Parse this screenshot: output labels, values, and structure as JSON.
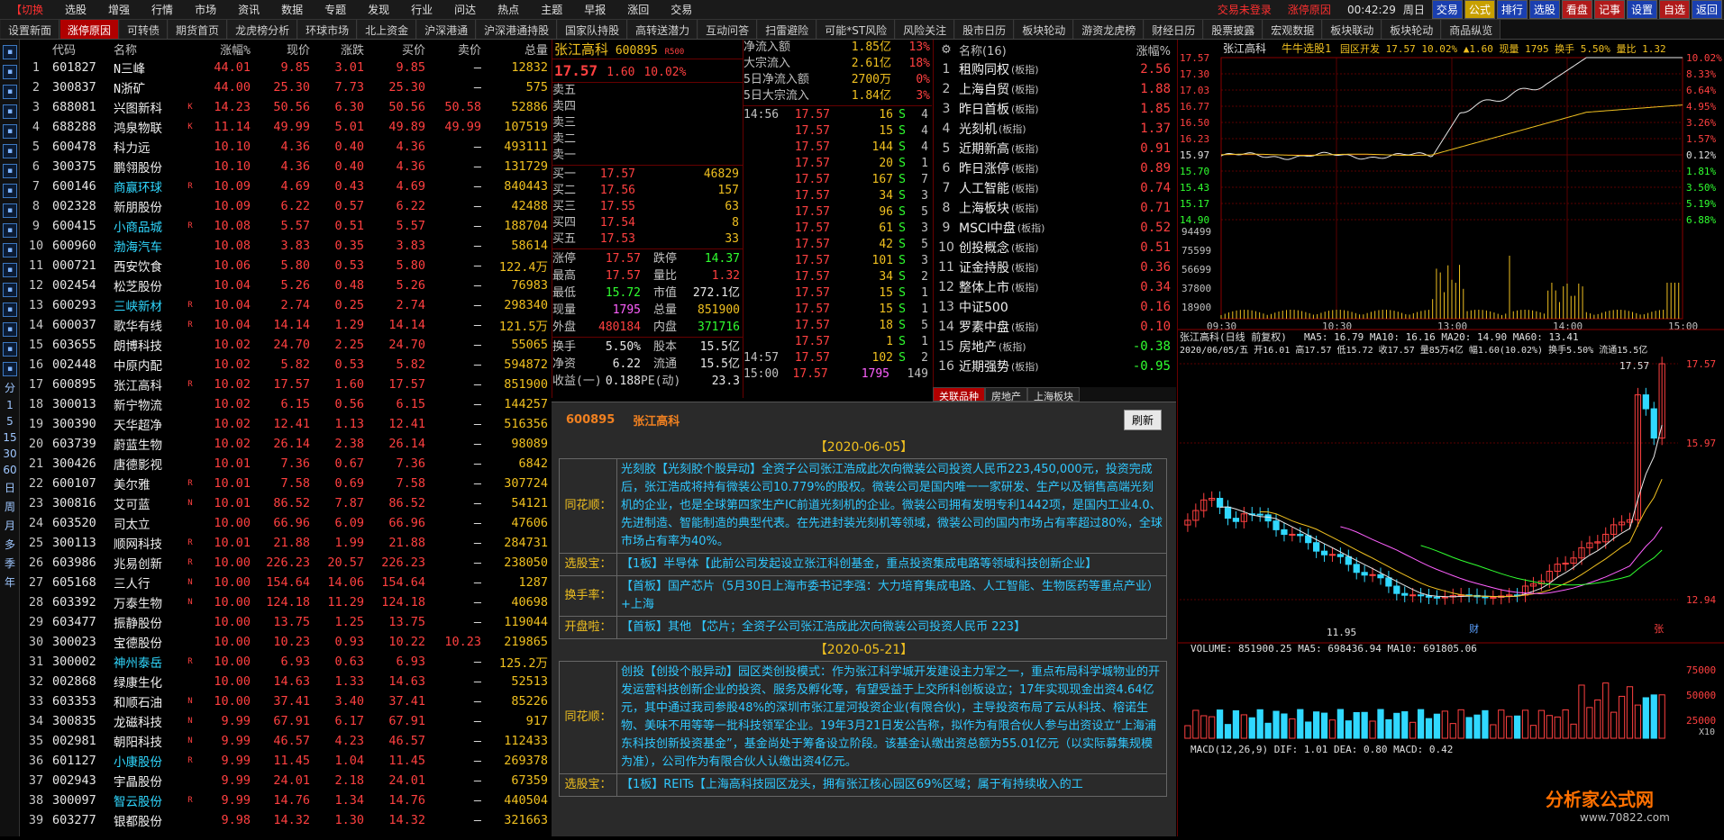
{
  "menubar": {
    "logo": "【切换",
    "items": [
      "选股",
      "增强",
      "行情",
      "市场",
      "资讯",
      "数据",
      "专题",
      "发现",
      "行业",
      "问达",
      "热点",
      "主题",
      "早报",
      "涨回",
      "交易"
    ],
    "alerts": [
      "交易未登录",
      "涨停原因"
    ],
    "time": "00:42:29",
    "weekday": "周日",
    "toolbuttons": [
      "交易",
      "公式",
      "排行",
      "选股",
      "看盘",
      "记事",
      "设置",
      "自选",
      "返回"
    ]
  },
  "tabs": [
    "设置新面",
    "涨停原因",
    "可转债",
    "期货首页",
    "龙虎榜分析",
    "环球市场",
    "北上资金",
    "沪深港通",
    "沪深港通持股",
    "国家队持股",
    "高转送潜力",
    "互动问答",
    "扫雷避险",
    "可能*ST风险",
    "风险关注",
    "股市日历",
    "板块轮动",
    "游资龙虎榜",
    "财经日历",
    "股票披露",
    "宏观数据",
    "板块联动",
    "板块轮动",
    "商品纵览"
  ],
  "active_tab": 1,
  "sidebar": {
    "periods": [
      "分",
      "1",
      "5",
      "15",
      "30",
      "60",
      "日",
      "周",
      "月",
      "多",
      "季",
      "年"
    ]
  },
  "list": {
    "headers": [
      "",
      "代码",
      "名称",
      "涨幅%",
      "现价",
      "涨跌",
      "买价",
      "卖价",
      "总量"
    ],
    "rows": [
      [
        "1",
        "601827",
        "N三峰",
        "",
        "44.01",
        "9.85",
        "3.01",
        "9.85",
        "–",
        "12832"
      ],
      [
        "2",
        "300837",
        "N浙矿",
        "",
        "44.00",
        "25.30",
        "7.73",
        "25.30",
        "–",
        "575"
      ],
      [
        "3",
        "688081",
        "兴图新科",
        "K",
        "14.23",
        "50.56",
        "6.30",
        "50.56",
        "50.58",
        "52886"
      ],
      [
        "4",
        "688288",
        "鸿泉物联",
        "K",
        "11.14",
        "49.99",
        "5.01",
        "49.89",
        "49.99",
        "107519"
      ],
      [
        "5",
        "600478",
        "科力远",
        "",
        "10.10",
        "4.36",
        "0.40",
        "4.36",
        "–",
        "493111"
      ],
      [
        "6",
        "300375",
        "鹏翎股份",
        "",
        "10.10",
        "4.36",
        "0.40",
        "4.36",
        "–",
        "131729"
      ],
      [
        "7",
        "600146",
        "商赢环球",
        "R",
        "10.09",
        "4.69",
        "0.43",
        "4.69",
        "–",
        "840443"
      ],
      [
        "8",
        "002328",
        "新朋股份",
        "",
        "10.09",
        "6.22",
        "0.57",
        "6.22",
        "–",
        "42488"
      ],
      [
        "9",
        "600415",
        "小商品城",
        "R",
        "10.08",
        "5.57",
        "0.51",
        "5.57",
        "–",
        "188704"
      ],
      [
        "10",
        "600960",
        "渤海汽车",
        "",
        "10.08",
        "3.83",
        "0.35",
        "3.83",
        "–",
        "58614"
      ],
      [
        "11",
        "000721",
        "西安饮食",
        "",
        "10.06",
        "5.80",
        "0.53",
        "5.80",
        "–",
        "122.4万"
      ],
      [
        "12",
        "002454",
        "松芝股份",
        "",
        "10.04",
        "5.26",
        "0.48",
        "5.26",
        "–",
        "76983"
      ],
      [
        "13",
        "600293",
        "三峡新材",
        "R",
        "10.04",
        "2.74",
        "0.25",
        "2.74",
        "–",
        "298340"
      ],
      [
        "14",
        "600037",
        "歌华有线",
        "R",
        "10.04",
        "14.14",
        "1.29",
        "14.14",
        "–",
        "121.5万"
      ],
      [
        "15",
        "603655",
        "朗博科技",
        "",
        "10.02",
        "24.70",
        "2.25",
        "24.70",
        "–",
        "55065"
      ],
      [
        "16",
        "002448",
        "中原内配",
        "",
        "10.02",
        "5.82",
        "0.53",
        "5.82",
        "–",
        "594872"
      ],
      [
        "17",
        "600895",
        "张江高科",
        "R",
        "10.02",
        "17.57",
        "1.60",
        "17.57",
        "–",
        "851900"
      ],
      [
        "18",
        "300013",
        "新宁物流",
        "",
        "10.02",
        "6.15",
        "0.56",
        "6.15",
        "–",
        "144257"
      ],
      [
        "19",
        "300390",
        "天华超净",
        "",
        "10.02",
        "12.41",
        "1.13",
        "12.41",
        "–",
        "516356"
      ],
      [
        "20",
        "603739",
        "蔚蓝生物",
        "",
        "10.02",
        "26.14",
        "2.38",
        "26.14",
        "–",
        "98089"
      ],
      [
        "21",
        "300426",
        "唐德影视",
        "",
        "10.01",
        "7.36",
        "0.67",
        "7.36",
        "–",
        "6842"
      ],
      [
        "22",
        "600107",
        "美尔雅",
        "R",
        "10.01",
        "7.58",
        "0.69",
        "7.58",
        "–",
        "307724"
      ],
      [
        "23",
        "300816",
        "艾可蓝",
        "N",
        "10.01",
        "86.52",
        "7.87",
        "86.52",
        "–",
        "54121"
      ],
      [
        "24",
        "603520",
        "司太立",
        "",
        "10.00",
        "66.96",
        "6.09",
        "66.96",
        "–",
        "47606"
      ],
      [
        "25",
        "300113",
        "顺网科技",
        "R",
        "10.01",
        "21.88",
        "1.99",
        "21.88",
        "–",
        "284731"
      ],
      [
        "26",
        "603986",
        "兆易创新",
        "R",
        "10.00",
        "226.23",
        "20.57",
        "226.23",
        "–",
        "238050"
      ],
      [
        "27",
        "605168",
        "三人行",
        "N",
        "10.00",
        "154.64",
        "14.06",
        "154.64",
        "–",
        "1287"
      ],
      [
        "28",
        "603392",
        "万泰生物",
        "N",
        "10.00",
        "124.18",
        "11.29",
        "124.18",
        "–",
        "40698"
      ],
      [
        "29",
        "603477",
        "振静股份",
        "",
        "10.00",
        "13.75",
        "1.25",
        "13.75",
        "–",
        "119044"
      ],
      [
        "30",
        "300023",
        "宝德股份",
        "",
        "10.00",
        "10.23",
        "0.93",
        "10.22",
        "10.23",
        "219865"
      ],
      [
        "31",
        "300002",
        "神州泰岳",
        "R",
        "10.00",
        "6.93",
        "0.63",
        "6.93",
        "–",
        "125.2万"
      ],
      [
        "32",
        "002868",
        "绿康生化",
        "",
        "10.00",
        "14.63",
        "1.33",
        "14.63",
        "–",
        "52513"
      ],
      [
        "33",
        "603353",
        "和顺石油",
        "N",
        "10.00",
        "37.41",
        "3.40",
        "37.41",
        "–",
        "85226"
      ],
      [
        "34",
        "300835",
        "龙磁科技",
        "N",
        "9.99",
        "67.91",
        "6.17",
        "67.91",
        "–",
        "917"
      ],
      [
        "35",
        "002981",
        "朝阳科技",
        "N",
        "9.99",
        "46.57",
        "4.23",
        "46.57",
        "–",
        "112433"
      ],
      [
        "36",
        "601127",
        "小康股份",
        "R",
        "9.99",
        "11.45",
        "1.04",
        "11.45",
        "–",
        "269378"
      ],
      [
        "37",
        "002943",
        "宇晶股份",
        "",
        "9.99",
        "24.01",
        "2.18",
        "24.01",
        "–",
        "67359"
      ],
      [
        "38",
        "300097",
        "智云股份",
        "R",
        "9.99",
        "14.76",
        "1.34",
        "14.76",
        "–",
        "440504"
      ],
      [
        "39",
        "603277",
        "银都股份",
        "",
        "9.98",
        "14.32",
        "1.30",
        "14.32",
        "–",
        "321663"
      ]
    ],
    "name_colors": {
      "7": "cyn",
      "9": "cyn",
      "10": "cyn",
      "13": "cyn",
      "31": "cyn",
      "36": "cyn",
      "38": "cyn"
    }
  },
  "quote": {
    "name": "张江高科",
    "code": "600895",
    "badge": "R500",
    "price": "17.57",
    "change": "1.60",
    "pct": "10.02%",
    "sells": [
      [
        "卖五",
        "",
        ""
      ],
      [
        "卖四",
        "",
        ""
      ],
      [
        "卖三",
        "",
        ""
      ],
      [
        "卖二",
        "",
        ""
      ],
      [
        "卖一",
        "",
        ""
      ]
    ],
    "buys": [
      [
        "买一",
        "17.57",
        "46829"
      ],
      [
        "买二",
        "17.56",
        "157"
      ],
      [
        "买三",
        "17.55",
        "63"
      ],
      [
        "买四",
        "17.54",
        "8"
      ],
      [
        "买五",
        "17.53",
        "33"
      ]
    ],
    "stats": [
      [
        "涨停",
        "17.57",
        "跌停",
        "14.37"
      ],
      [
        "最高",
        "17.57",
        "量比",
        "1.32"
      ],
      [
        "最低",
        "15.72",
        "市值",
        "272.1亿"
      ],
      [
        "现量",
        "1795",
        "总量",
        "851900"
      ],
      [
        "外盘",
        "480184",
        "内盘",
        "371716"
      ]
    ],
    "stats2": [
      [
        "换手",
        "5.50%",
        "股本",
        "15.5亿"
      ],
      [
        "净资",
        "6.22",
        "流通",
        "15.5亿"
      ],
      [
        "收益(一)",
        "0.188",
        "PE(动)",
        "23.3"
      ]
    ]
  },
  "flows": [
    [
      "净流入额",
      "1.85亿",
      "13%"
    ],
    [
      "大宗流入",
      "2.61亿",
      "18%"
    ],
    [
      "5日净流入额",
      "2700万",
      "0%"
    ],
    [
      "5日大宗流入",
      "1.84亿",
      "3%"
    ]
  ],
  "ticks": [
    [
      "14:56",
      "17.57",
      "16",
      "S",
      "4"
    ],
    [
      "",
      "17.57",
      "15",
      "S",
      "4"
    ],
    [
      "",
      "17.57",
      "144",
      "S",
      "4"
    ],
    [
      "",
      "17.57",
      "20",
      "S",
      "1"
    ],
    [
      "",
      "17.57",
      "167",
      "S",
      "7"
    ],
    [
      "",
      "17.57",
      "34",
      "S",
      "3"
    ],
    [
      "",
      "17.57",
      "96",
      "S",
      "5"
    ],
    [
      "",
      "17.57",
      "61",
      "S",
      "3"
    ],
    [
      "",
      "17.57",
      "42",
      "S",
      "5"
    ],
    [
      "",
      "17.57",
      "101",
      "S",
      "3"
    ],
    [
      "",
      "17.57",
      "34",
      "S",
      "2"
    ],
    [
      "",
      "17.57",
      "15",
      "S",
      "1"
    ],
    [
      "",
      "17.57",
      "15",
      "S",
      "1"
    ],
    [
      "",
      "17.57",
      "18",
      "S",
      "5"
    ],
    [
      "",
      "17.57",
      "1",
      "S",
      "1"
    ],
    [
      "14:57",
      "17.57",
      "102",
      "S",
      "2"
    ],
    [
      "15:00",
      "17.57",
      "1795",
      "",
      "149"
    ]
  ],
  "related": {
    "header": "名称(16)",
    "header_col": "涨幅%",
    "rows": [
      [
        "1",
        "租购同权",
        "(板指)",
        "2.56"
      ],
      [
        "2",
        "上海自贸",
        "(板指)",
        "1.88"
      ],
      [
        "3",
        "昨日首板",
        "(板指)",
        "1.85"
      ],
      [
        "4",
        "光刻机",
        "(板指)",
        "1.37"
      ],
      [
        "5",
        "近期新高",
        "(板指)",
        "0.91"
      ],
      [
        "6",
        "昨日涨停",
        "(板指)",
        "0.89"
      ],
      [
        "7",
        "人工智能",
        "(板指)",
        "0.74"
      ],
      [
        "8",
        "上海板块",
        "(板指)",
        "0.71"
      ],
      [
        "9",
        "MSCI中盘",
        "(板指)",
        "0.52"
      ],
      [
        "10",
        "创投概念",
        "(板指)",
        "0.51"
      ],
      [
        "11",
        "证金持股",
        "(板指)",
        "0.36"
      ],
      [
        "12",
        "整体上市",
        "(板指)",
        "0.34"
      ],
      [
        "13",
        "中证500",
        "",
        "0.16"
      ],
      [
        "14",
        "罗素中盘",
        "(板指)",
        "0.10"
      ],
      [
        "15",
        "房地产",
        "(板指)",
        "-0.38"
      ],
      [
        "16",
        "近期强势",
        "(板指)",
        "-0.95"
      ]
    ],
    "tabs": [
      "关联品种",
      "房地产",
      "上海板块"
    ]
  },
  "news": {
    "code": "600895",
    "name": "张江高科",
    "refresh": "刷新",
    "sections": [
      {
        "date": "【2020-06-05】",
        "items": [
          [
            "同花顺：",
            "光刻胶【光刻胶个股异动】全资子公司张江浩成此次向微装公司投资人民币223,450,000元，投资完成后，张江浩成将持有微装公司10.779%的股权。微装公司是国内唯一一家研发、生产以及销售高端光刻机的企业，也是全球第四家生产IC前道光刻机的企业。微装公司拥有发明专利1442项，是国内工业4.0、先进制造、智能制造的典型代表。在先进封装光刻机等领域，微装公司的国内市场占有率超过80%，全球市场占有率为40%。"
          ],
          [
            "选股宝：",
            "【1板】半导体【此前公司发起设立张江科创基金，重点投资集成电路等领域科技创新企业】"
          ],
          [
            "换手率：",
            "【首板】国产芯片（5月30日上海市委书记李强：大力培育集成电路、人工智能、生物医药等重点产业）+上海"
          ],
          [
            "开盘啦：",
            "【首板】其他 【芯片；全资子公司张江浩成此次向微装公司投资人民币 223】"
          ]
        ]
      },
      {
        "date": "【2020-05-21】",
        "items": [
          [
            "同花顺：",
            "创投【创投个股异动】园区类创投模式：作为张江科学城开发建设主力军之一，重点布局科学城物业的开发运营科技创新企业的投资、服务及孵化等，有望受益于上交所科创板设立；17年实现现金出资4.64亿元，其中通过我司参股48%的深圳市张江星河投资企业(有限合伙)，主导投资布局了云从科技、榕诺生物、美味不用等等一批科技领军企业。19年3月21日发公告称，拟作为有限合伙人参与出资设立“上海浦东科技创新投资基金”，基金尚处于筹备设立阶段。该基金认缴出资总额为55.01亿元（以实际募集规模为准），公司作为有限合伙人认缴出资4亿元。"
          ],
          [
            "选股宝：",
            "【1板】REITs【上海高科技园区龙头，拥有张江核心园区69%区域；属于有持续收入的工"
          ]
        ]
      }
    ]
  },
  "chart": {
    "intraday": {
      "title": "张江高科",
      "subtitle": "牛牛选股1",
      "tags": "园区开发 17.57 10.02% ▲1.60 现量 1795 换手 5.50% 量比 1.32",
      "ylabels_left": [
        "17.57",
        "17.30",
        "17.03",
        "16.77",
        "16.50",
        "16.23",
        "15.97",
        "15.70",
        "15.43",
        "15.17",
        "14.90"
      ],
      "ylabels_right": [
        "10.02%",
        "8.33%",
        "6.64%",
        "4.95%",
        "3.26%",
        "1.57%",
        "0.12%",
        "1.81%",
        "3.50%",
        "5.19%",
        "6.88%"
      ],
      "vol_labels": [
        "94499",
        "75599",
        "56699",
        "37800",
        "18900"
      ],
      "time_labels": [
        "09:30",
        "10:30",
        "13:00",
        "14:00",
        "15:00"
      ]
    },
    "daily": {
      "title": "张江高科(日线 前复权)",
      "ma_line": "MA5: 16.79  MA10: 16.16  MA20: 14.90  MA60: 13.41",
      "info_line": "2020/06/05/五 开16.01 高17.57 低15.72 收17.57 量85万4亿 幅1.60(10.02%) 换手5.50% 流通15.5亿",
      "high_label": "17.57",
      "low_label": "11.95",
      "ylabels": [
        "17.57",
        "15.97",
        "12.94"
      ],
      "markers": [
        "财",
        "张"
      ],
      "volume_line": "VOLUME: 851900.25  MA5: 698436.94  MA10: 691805.06",
      "vol_ylabels": [
        "75000",
        "50000",
        "25000"
      ],
      "x10": "X10",
      "macd_line": "MACD(12,26,9)  DIF: 1.01  DEA: 0.80  MACD: 0.42"
    }
  },
  "watermark": {
    "title": "分析家公式网",
    "site": "www.70822.com"
  }
}
